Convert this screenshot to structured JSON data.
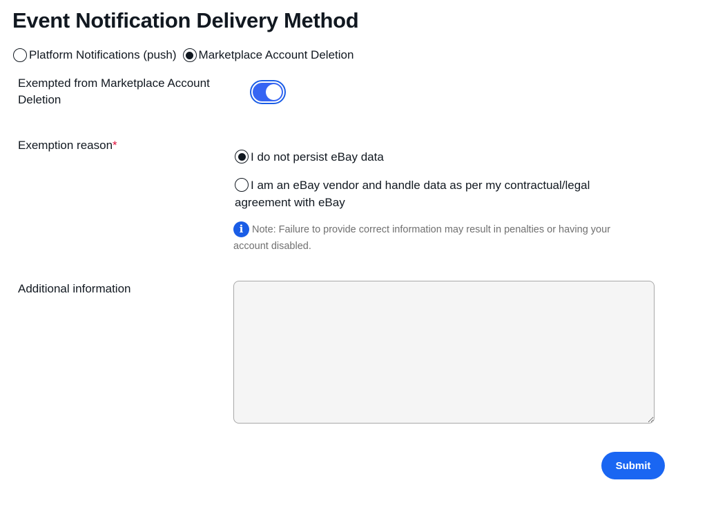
{
  "page": {
    "title": "Event Notification Delivery Method"
  },
  "delivery_method": {
    "options": [
      {
        "label": "Platform Notifications (push)",
        "selected": false
      },
      {
        "label": "Marketplace Account Deletion",
        "selected": true
      }
    ]
  },
  "exemption": {
    "toggle_label": "Exempted from Marketplace Account Deletion",
    "toggle_on": true
  },
  "exemption_reason": {
    "label": "Exemption reason",
    "required_marker": "*",
    "options": [
      {
        "label": "I do not persist eBay data",
        "selected": true
      },
      {
        "label": "I am an eBay vendor and handle data as per my contractual/legal agreement with eBay",
        "selected": false
      }
    ],
    "note_icon": "i",
    "note": "Note: Failure to provide correct information may result in penalties or having your account disabled."
  },
  "additional_information": {
    "label": "Additional information",
    "value": "",
    "placeholder": ""
  },
  "actions": {
    "submit_label": "Submit"
  },
  "colors": {
    "accent": "#1a66f2",
    "required": "#e0103a",
    "note_text": "#707070"
  }
}
